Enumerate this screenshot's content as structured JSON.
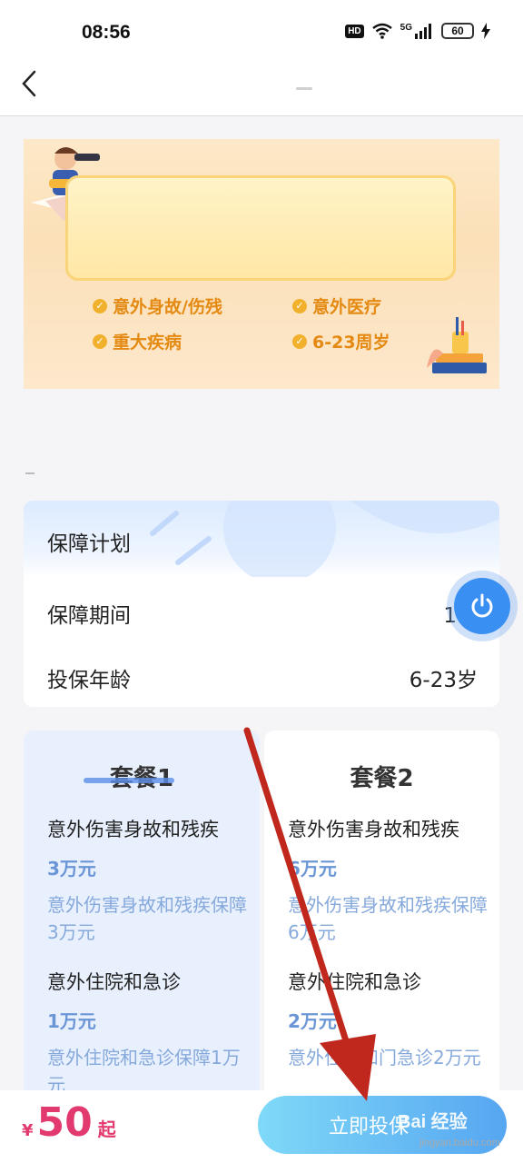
{
  "status_bar": {
    "time": "08:56",
    "hd": "HD",
    "network": "5G",
    "battery": "60"
  },
  "banner": {
    "features": [
      "意外身故/伤残",
      "意外医疗",
      "重大疾病",
      "6-23周岁"
    ],
    "accent_color": "#e48a12"
  },
  "plan": {
    "title": "保障计划",
    "rows": [
      {
        "label": "保障期间",
        "value": "1年"
      },
      {
        "label": "投保年龄",
        "value": "6-23岁"
      }
    ]
  },
  "packages": [
    {
      "title": "套餐1",
      "items": [
        {
          "name": "意外伤害身故和残疾",
          "amount": "3万元",
          "desc": "意外伤害身故和残疾保障3万元"
        },
        {
          "name": "意外住院和急诊",
          "amount": "1万元",
          "desc": "意外住院和急诊保障1万元"
        }
      ]
    },
    {
      "title": "套餐2",
      "items": [
        {
          "name": "意外伤害身故和残疾",
          "amount": "6万元",
          "desc": "意外伤害身故和残疾保障6万元"
        },
        {
          "name": "意外住院和急诊",
          "amount": "2万元",
          "desc": "意外住院和门急诊2万元"
        }
      ]
    }
  ],
  "bottom": {
    "currency": "¥",
    "price": "50",
    "suffix": "起",
    "cta_label": "立即投保",
    "price_color": "#e23a6e"
  },
  "watermark": {
    "text": "Bai 经验",
    "sub": "jingyan.baidu.com"
  }
}
